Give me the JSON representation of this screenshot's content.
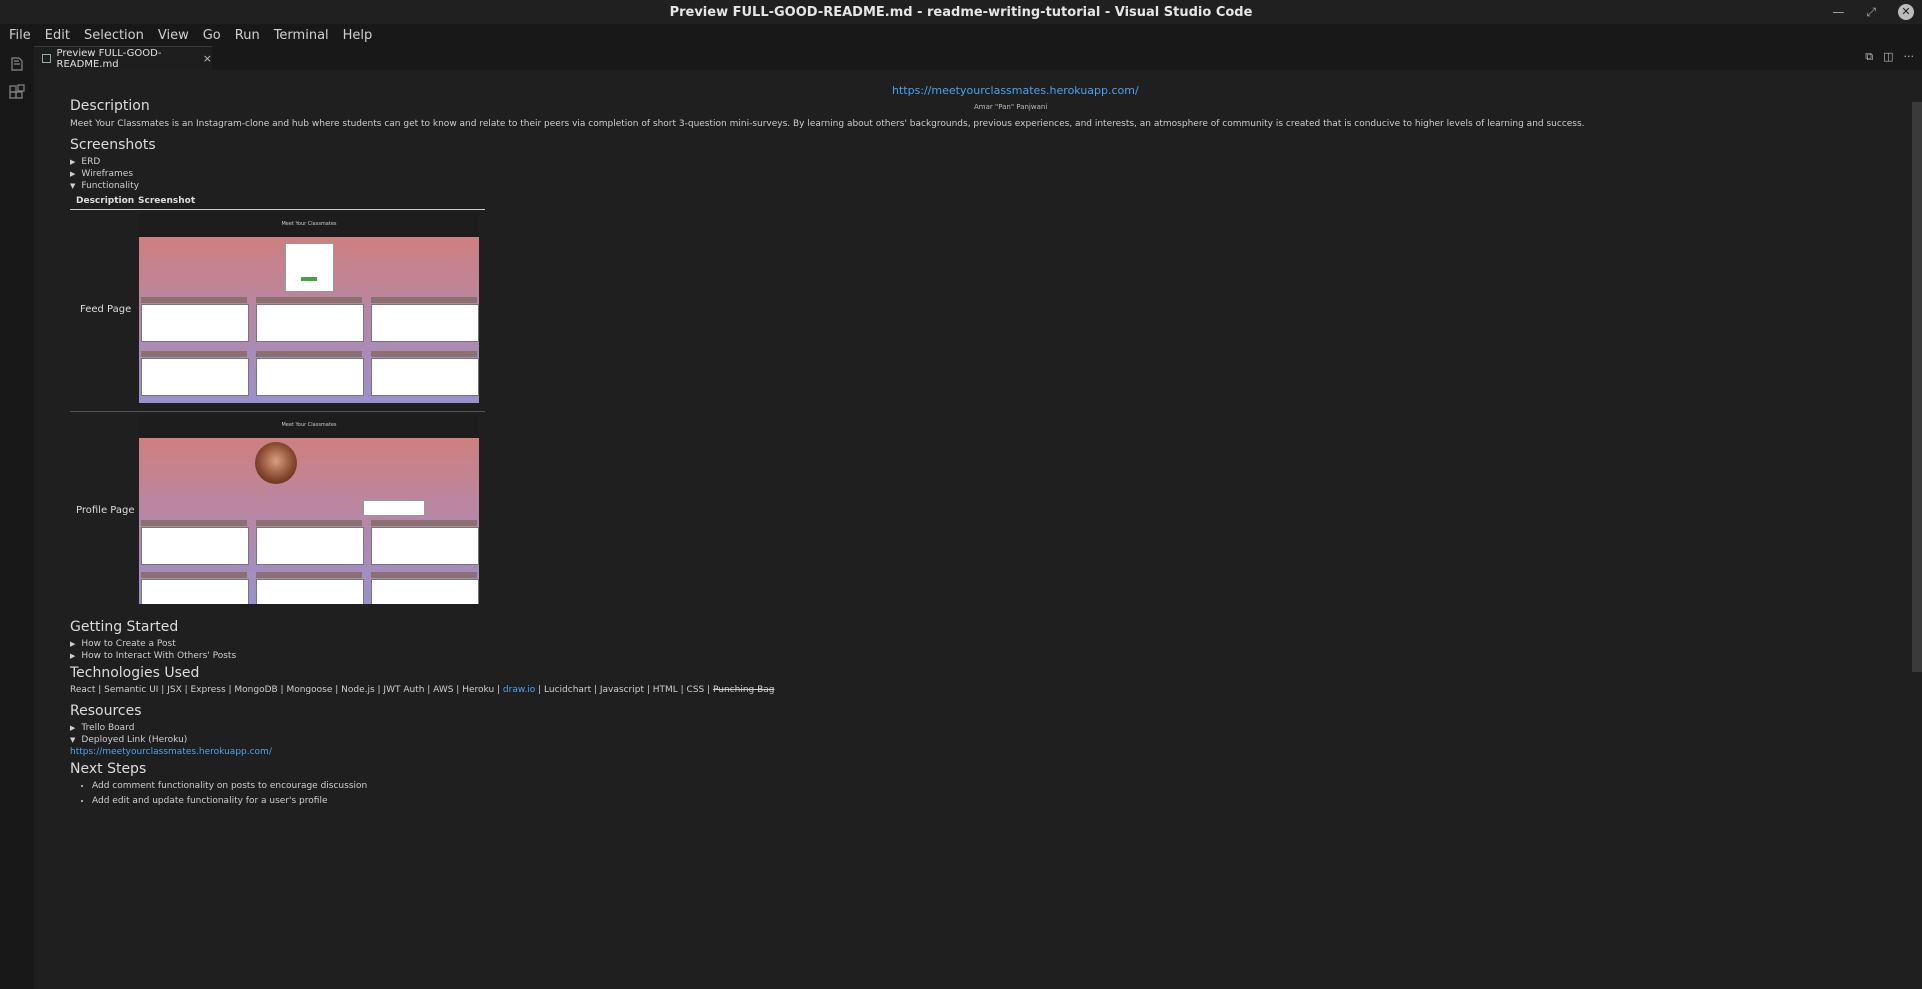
{
  "window": {
    "title": "Preview FULL-GOOD-README.md - readme-writing-tutorial - Visual Studio Code"
  },
  "menu": [
    "File",
    "Edit",
    "Selection",
    "View",
    "Go",
    "Run",
    "Terminal",
    "Help"
  ],
  "tab": {
    "label": "Preview FULL-GOOD-README.md",
    "close": "×"
  },
  "doc": {
    "top_link": "https://meetyourclassmates.herokuapp.com/",
    "author": "Amar \"Pan\" Panjwani",
    "description_heading": "Description",
    "description_text": "Meet Your Classmates is an Instagram-clone and hub where students can get to know and relate to their peers via completion of short 3-question mini-surveys. By learning about others' backgrounds, previous experiences, and interests, an atmosphere of community is created that is conducive to higher levels of learning and success.",
    "screenshots_heading": "Screenshots",
    "screenshots_details": [
      {
        "label": "ERD",
        "open": false
      },
      {
        "label": "Wireframes",
        "open": false
      },
      {
        "label": "Functionality",
        "open": true
      }
    ],
    "func_table": {
      "headers": [
        "Description",
        "Screenshot"
      ],
      "rows": [
        "Feed Page",
        "Profile Page"
      ]
    },
    "shot_brand": "Meet Your Classmates",
    "getting_started_heading": "Getting Started",
    "getting_started_details": [
      {
        "label": "How to Create a Post",
        "open": false
      },
      {
        "label": "How to Interact With Others' Posts",
        "open": false
      }
    ],
    "tech_heading": "Technologies Used",
    "tech_before": "React | Semantic UI | JSX | Express | MongoDB | Mongoose | Node.js | JWT Auth | AWS | Heroku | ",
    "tech_link": "draw.io",
    "tech_after": " | Lucidchart | Javascript | HTML | CSS | ",
    "tech_struck": "Punching Bag",
    "resources_heading": "Resources",
    "resources_details": [
      {
        "label": "Trello Board",
        "open": false
      },
      {
        "label": "Deployed Link (Heroku)",
        "open": true
      }
    ],
    "deployed_link": "https://meetyourclassmates.herokuapp.com/",
    "next_heading": "Next Steps",
    "next_items": [
      "Add comment functionality on posts to encourage discussion",
      "Add edit and update functionality for a user's profile"
    ]
  }
}
